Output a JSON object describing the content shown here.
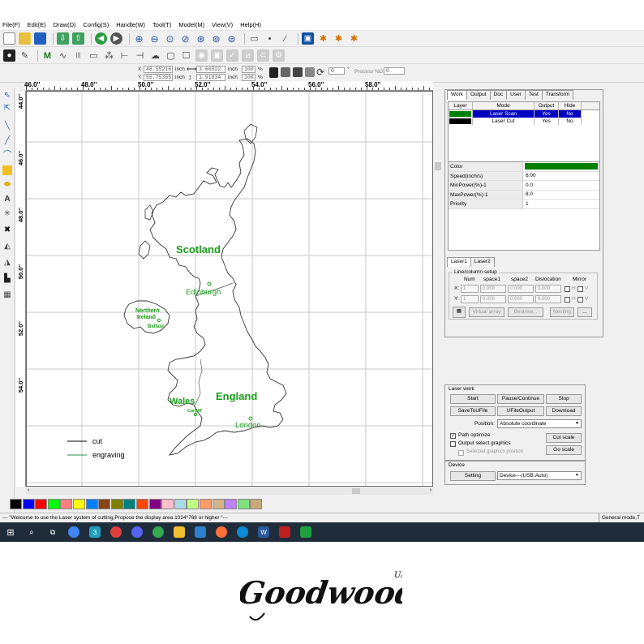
{
  "menu": [
    "File(F)",
    "Edit(E)",
    "Draw(D)",
    "Config(S)",
    "Handle(W)",
    "Tool(T)",
    "Model(M)",
    "View(V)",
    "Help(H)"
  ],
  "toolbar_icons": [
    "new-file-icon",
    "open-folder-icon",
    "save-icon",
    "import-icon",
    "export-icon",
    "back-icon",
    "forward-icon",
    "zoom-in-icon",
    "zoom-out-icon",
    "zoom-fit-icon",
    "zoom-select-icon",
    "zoom-page-icon",
    "zoom-pan-icon",
    "zoom-window-icon",
    "rectangle-icon",
    "node-icon",
    "wand-icon",
    "monitor-icon",
    "star-icon"
  ],
  "coords": {
    "x_label": "X",
    "x_value": "48.55216",
    "x_unit": "inch",
    "w_value": "3.66522",
    "w_unit": "inch",
    "w_pct": "100",
    "w_pct_unit": "%",
    "y_label": "Y",
    "y_value": "55.75355",
    "y_unit": "inch",
    "h_value": "1.91834",
    "h_unit": "inch",
    "h_pct": "100",
    "h_pct_unit": "%",
    "rotate_value": "0",
    "rotate_unit": "°",
    "process_label": "Process NO:",
    "process_value": "0"
  },
  "ruler": {
    "h_labels": [
      "46.0''",
      "48.0''",
      "50.0''",
      "52.0''",
      "54.0''",
      "56.0''",
      "58.0''"
    ],
    "v_labels": [
      "44.0''",
      "46.0''",
      "48.0''",
      "50.0''",
      "52.0''",
      "54.0''"
    ]
  },
  "map": {
    "labels": {
      "scotland": "Scotland",
      "edinburgh": "Edinburgh",
      "northern_ireland_1": "Northern",
      "northern_ireland_2": "Ireland",
      "belfast": "Belfast",
      "wales": "Wales",
      "cardiff": "Cardiff",
      "england": "England",
      "london": "London"
    },
    "legend": [
      {
        "label": "cut",
        "color": "#000000"
      },
      {
        "label": "engraving",
        "color": "#2e8b57"
      }
    ],
    "label_color": "#1a9e1a"
  },
  "panel": {
    "tabs": [
      "Work",
      "Output",
      "Doc",
      "User",
      "Test",
      "Transform"
    ],
    "active_tab": "Work",
    "layer_headers": [
      "Layer",
      "Mode",
      "Output",
      "Hide"
    ],
    "layers": [
      {
        "color": "#008000",
        "mode": "Laser Scan",
        "output": "Yes",
        "hide": "No",
        "selected": true
      },
      {
        "color": "#000000",
        "mode": "Laser Cut",
        "output": "Yes",
        "hide": "No",
        "selected": false
      }
    ],
    "properties": [
      {
        "key": "Color",
        "value": ""
      },
      {
        "key": "Speed(inch/s)",
        "value": "6.00"
      },
      {
        "key": "MinPower(%)-1",
        "value": "0.0"
      },
      {
        "key": "MaxPower(%)-1",
        "value": "8.0"
      },
      {
        "key": "Priority",
        "value": "1"
      }
    ],
    "color_swatch": "#008000",
    "laser_tabs": [
      "Laser1",
      "Laser2"
    ],
    "line_setup": {
      "title": "Line/column setup",
      "headers": [
        "Num",
        "space1",
        "space2",
        "Dislocation",
        "Mirror"
      ],
      "x_label": "X:",
      "y_label": "Y:",
      "x_values": [
        "1",
        "0.000",
        "0.000",
        "0.000"
      ],
      "y_values": [
        "1",
        "0.000",
        "0.000",
        "0.000"
      ],
      "h_label": "H",
      "v_label": "V",
      "buttons": [
        "Virtual array",
        "Bestrew...",
        "Nesting",
        "..."
      ]
    }
  },
  "laser_work": {
    "title": "Laser work",
    "buttons": [
      "Start",
      "Pause/Continue",
      "Stop",
      "SaveToUFile",
      "UFileOutput",
      "Download"
    ],
    "position_label": "Position:",
    "position_value": "Absolute coordinate",
    "path_optimize": "Path optimize",
    "output_select": "Output select graphics",
    "selected_position": "Selected graphics position",
    "cut_scale": "Cut scale",
    "go_scale": "Go scale"
  },
  "device": {
    "title": "Device",
    "setting_button": "Setting",
    "device_value": "Device---(USB:Auto)"
  },
  "palette": [
    "#000000",
    "#0000ff",
    "#ff0000",
    "#00ff00",
    "#ff8080",
    "#ffff00",
    "#0080ff",
    "#8b4513",
    "#808000",
    "#008080",
    "#ff4500",
    "#800080",
    "#ffc0cb",
    "#add8e6",
    "#c0ff80",
    "#ff9966",
    "#d2b48c",
    "#c080ff",
    "#80e080",
    "#c8a878"
  ],
  "status": {
    "message": "--- \"Welcome to use the Laser system of cutting,Propose the display area 1024*768 or higher \"---",
    "mode": "General mode,T"
  },
  "taskbar_icons": [
    "windows-start-icon",
    "search-icon",
    "task-view-icon",
    "chrome-icon",
    "app-3-icon",
    "chrome-2-icon",
    "discord-icon",
    "chrome-3-icon",
    "file-explorer-icon",
    "photos-icon",
    "firefox-icon",
    "edge-icon",
    "word-icon",
    "app-red-icon",
    "app-green-icon"
  ],
  "watermark": {
    "brand": "Goodwood",
    "suffix": "UA"
  }
}
